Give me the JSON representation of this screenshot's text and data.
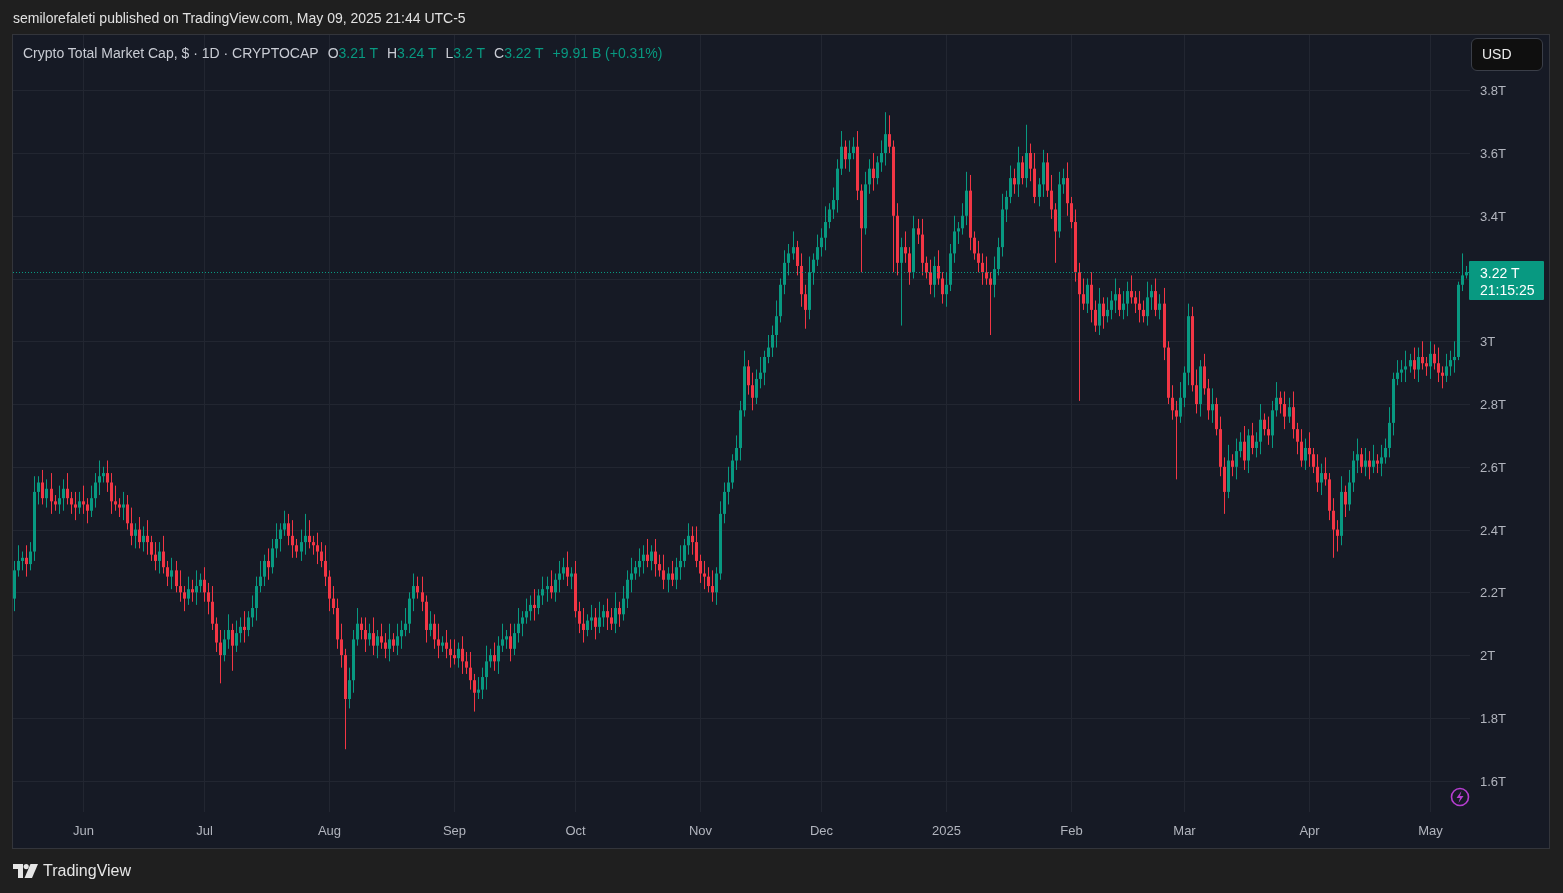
{
  "header": {
    "text": "semilorefaleti published on TradingView.com, May 09, 2025 21:44 UTC-5"
  },
  "legend": {
    "symbol": "Crypto Total Market Cap, $ · 1D · CRYPTOCAP",
    "items": [
      {
        "label": "O",
        "value": "3.21 T"
      },
      {
        "label": "H",
        "value": "3.24 T"
      },
      {
        "label": "L",
        "value": "3.2 T"
      },
      {
        "label": "C",
        "value": "3.22 T"
      }
    ],
    "change": "+9.91 B (+0.31%)"
  },
  "currency_button": {
    "label": "USD"
  },
  "price_tag": {
    "countdown": "21:15:25"
  },
  "chart_data": {
    "type": "candlestick",
    "grid": true,
    "ylim": [
      1.5,
      3.976
    ],
    "yticks": [
      {
        "value": 1.6,
        "label": "1.6T"
      },
      {
        "value": 1.8,
        "label": "1.8T"
      },
      {
        "value": 2,
        "label": "2T"
      },
      {
        "value": 2.2,
        "label": "2.2T"
      },
      {
        "value": 2.4,
        "label": "2.4T"
      },
      {
        "value": 2.6,
        "label": "2.6T"
      },
      {
        "value": 2.8,
        "label": "2.8T"
      },
      {
        "value": 3,
        "label": "3T"
      },
      {
        "value": 3.4,
        "label": "3.4T"
      },
      {
        "value": 3.6,
        "label": "3.6T"
      },
      {
        "value": 3.8,
        "label": "3.8T"
      }
    ],
    "ref_lines": [
      {
        "axis": "y",
        "value": 3.22,
        "label": "3.22 T"
      }
    ],
    "categories": [
      null,
      null,
      null,
      null,
      null,
      null,
      null,
      null,
      null,
      null,
      null,
      null,
      null,
      null,
      null,
      null,
      null,
      "Jun",
      null,
      null,
      null,
      null,
      null,
      null,
      null,
      null,
      null,
      null,
      null,
      null,
      null,
      null,
      null,
      null,
      null,
      null,
      null,
      null,
      null,
      null,
      null,
      null,
      null,
      null,
      null,
      null,
      null,
      "Jul",
      null,
      null,
      null,
      null,
      null,
      null,
      null,
      null,
      null,
      null,
      null,
      null,
      null,
      null,
      null,
      null,
      null,
      null,
      null,
      null,
      null,
      null,
      null,
      null,
      null,
      null,
      null,
      null,
      null,
      null,
      "Aug",
      null,
      null,
      null,
      null,
      null,
      null,
      null,
      null,
      null,
      null,
      null,
      null,
      null,
      null,
      null,
      null,
      null,
      null,
      null,
      null,
      null,
      null,
      null,
      null,
      null,
      null,
      null,
      null,
      null,
      null,
      "Sep",
      null,
      null,
      null,
      null,
      null,
      null,
      null,
      null,
      null,
      null,
      null,
      null,
      null,
      null,
      null,
      null,
      null,
      null,
      null,
      null,
      null,
      null,
      null,
      null,
      null,
      null,
      null,
      null,
      null,
      "Oct",
      null,
      null,
      null,
      null,
      null,
      null,
      null,
      null,
      null,
      null,
      null,
      null,
      null,
      null,
      null,
      null,
      null,
      null,
      null,
      null,
      null,
      null,
      null,
      null,
      null,
      null,
      null,
      null,
      null,
      null,
      "Nov",
      null,
      null,
      null,
      null,
      null,
      null,
      null,
      null,
      null,
      null,
      null,
      null,
      null,
      null,
      null,
      null,
      null,
      null,
      null,
      null,
      null,
      null,
      null,
      null,
      null,
      null,
      null,
      null,
      null,
      "Dec",
      null,
      null,
      null,
      null,
      null,
      null,
      null,
      null,
      null,
      null,
      null,
      null,
      null,
      null,
      null,
      null,
      null,
      null,
      null,
      null,
      null,
      null,
      null,
      null,
      null,
      null,
      null,
      null,
      null,
      null,
      "2025",
      null,
      null,
      null,
      null,
      null,
      null,
      null,
      null,
      null,
      null,
      null,
      null,
      null,
      null,
      null,
      null,
      null,
      null,
      null,
      null,
      null,
      null,
      null,
      null,
      null,
      null,
      null,
      null,
      null,
      null,
      "Feb",
      null,
      null,
      null,
      null,
      null,
      null,
      null,
      null,
      null,
      null,
      null,
      null,
      null,
      null,
      null,
      null,
      null,
      null,
      null,
      null,
      null,
      null,
      null,
      null,
      null,
      null,
      null,
      "Mar",
      null,
      null,
      null,
      null,
      null,
      null,
      null,
      null,
      null,
      null,
      null,
      null,
      null,
      null,
      null,
      null,
      null,
      null,
      null,
      null,
      null,
      null,
      null,
      null,
      null,
      null,
      null,
      null,
      null,
      null,
      "Apr",
      null,
      null,
      null,
      null,
      null,
      null,
      null,
      null,
      null,
      null,
      null,
      null,
      null,
      null,
      null,
      null,
      null,
      null,
      null,
      null,
      null,
      null,
      null,
      null,
      null,
      null,
      null,
      null,
      null,
      "May",
      null,
      null,
      null,
      null,
      null,
      null,
      null,
      null,
      null
    ],
    "ohlc": [
      [
        2.18,
        2.3,
        2.14,
        2.27
      ],
      [
        2.27,
        2.35,
        2.25,
        2.3
      ],
      [
        2.3,
        2.33,
        2.27,
        2.31
      ],
      [
        2.31,
        2.35,
        2.25,
        2.29
      ],
      [
        2.29,
        2.36,
        2.27,
        2.33
      ],
      [
        2.33,
        2.57,
        2.3,
        2.52
      ],
      [
        2.52,
        2.57,
        2.48,
        2.55
      ],
      [
        2.55,
        2.59,
        2.48,
        2.5
      ],
      [
        2.5,
        2.56,
        2.47,
        2.53
      ],
      [
        2.53,
        2.58,
        2.45,
        2.49
      ],
      [
        2.49,
        2.51,
        2.46,
        2.48
      ],
      [
        2.48,
        2.54,
        2.45,
        2.5
      ],
      [
        2.5,
        2.56,
        2.46,
        2.53
      ],
      [
        2.53,
        2.58,
        2.48,
        2.5
      ],
      [
        2.5,
        2.52,
        2.45,
        2.48
      ],
      [
        2.48,
        2.52,
        2.43,
        2.47
      ],
      [
        2.47,
        2.52,
        2.45,
        2.49
      ],
      [
        2.49,
        2.54,
        2.45,
        2.48
      ],
      [
        2.48,
        2.5,
        2.42,
        2.46
      ],
      [
        2.46,
        2.54,
        2.44,
        2.5
      ],
      [
        2.5,
        2.58,
        2.47,
        2.55
      ],
      [
        2.55,
        2.62,
        2.51,
        2.57
      ],
      [
        2.57,
        2.6,
        2.55,
        2.58
      ],
      [
        2.58,
        2.62,
        2.52,
        2.55
      ],
      [
        2.55,
        2.58,
        2.45,
        2.49
      ],
      [
        2.49,
        2.54,
        2.46,
        2.48
      ],
      [
        2.48,
        2.5,
        2.44,
        2.47
      ],
      [
        2.47,
        2.52,
        2.43,
        2.48
      ],
      [
        2.48,
        2.51,
        2.4,
        2.42
      ],
      [
        2.42,
        2.47,
        2.35,
        2.38
      ],
      [
        2.38,
        2.42,
        2.34,
        2.4
      ],
      [
        2.4,
        2.44,
        2.34,
        2.36
      ],
      [
        2.36,
        2.41,
        2.33,
        2.38
      ],
      [
        2.38,
        2.43,
        2.32,
        2.36
      ],
      [
        2.36,
        2.38,
        2.3,
        2.32
      ],
      [
        2.32,
        2.36,
        2.27,
        2.3
      ],
      [
        2.3,
        2.36,
        2.26,
        2.33
      ],
      [
        2.33,
        2.38,
        2.26,
        2.28
      ],
      [
        2.28,
        2.3,
        2.22,
        2.25
      ],
      [
        2.25,
        2.31,
        2.21,
        2.27
      ],
      [
        2.27,
        2.3,
        2.2,
        2.22
      ],
      [
        2.22,
        2.27,
        2.17,
        2.2
      ],
      [
        2.2,
        2.22,
        2.14,
        2.18
      ],
      [
        2.18,
        2.25,
        2.16,
        2.21
      ],
      [
        2.21,
        2.24,
        2.17,
        2.2
      ],
      [
        2.2,
        2.27,
        2.16,
        2.22
      ],
      [
        2.22,
        2.26,
        2.2,
        2.24
      ],
      [
        2.24,
        2.28,
        2.17,
        2.2
      ],
      [
        2.2,
        2.23,
        2.13,
        2.17
      ],
      [
        2.17,
        2.22,
        2.08,
        2.1
      ],
      [
        2.1,
        2.12,
        2.01,
        2.04
      ],
      [
        2.04,
        2.08,
        1.91,
        2.0
      ],
      [
        2.0,
        2.08,
        1.98,
        2.05
      ],
      [
        2.05,
        2.13,
        2.02,
        2.08
      ],
      [
        2.08,
        2.1,
        1.95,
        2.03
      ],
      [
        2.03,
        2.11,
        2.01,
        2.07
      ],
      [
        2.07,
        2.12,
        2.04,
        2.09
      ],
      [
        2.09,
        2.14,
        2.04,
        2.08
      ],
      [
        2.08,
        2.14,
        2.06,
        2.12
      ],
      [
        2.12,
        2.19,
        2.09,
        2.15
      ],
      [
        2.15,
        2.25,
        2.11,
        2.22
      ],
      [
        2.22,
        2.3,
        2.2,
        2.25
      ],
      [
        2.25,
        2.32,
        2.22,
        2.3
      ],
      [
        2.3,
        2.34,
        2.24,
        2.28
      ],
      [
        2.28,
        2.37,
        2.26,
        2.34
      ],
      [
        2.34,
        2.42,
        2.31,
        2.37
      ],
      [
        2.37,
        2.42,
        2.33,
        2.4
      ],
      [
        2.4,
        2.46,
        2.38,
        2.42
      ],
      [
        2.42,
        2.45,
        2.35,
        2.38
      ],
      [
        2.38,
        2.43,
        2.31,
        2.35
      ],
      [
        2.35,
        2.37,
        2.31,
        2.33
      ],
      [
        2.33,
        2.4,
        2.3,
        2.36
      ],
      [
        2.36,
        2.45,
        2.32,
        2.38
      ],
      [
        2.38,
        2.43,
        2.34,
        2.36
      ],
      [
        2.36,
        2.38,
        2.32,
        2.35
      ],
      [
        2.35,
        2.39,
        2.29,
        2.33
      ],
      [
        2.33,
        2.36,
        2.28,
        2.3
      ],
      [
        2.3,
        2.35,
        2.22,
        2.25
      ],
      [
        2.25,
        2.27,
        2.14,
        2.18
      ],
      [
        2.18,
        2.22,
        2.13,
        2.15
      ],
      [
        2.15,
        2.18,
        2.02,
        2.05
      ],
      [
        2.05,
        2.1,
        1.96,
        2.0
      ],
      [
        2.0,
        2.02,
        1.7,
        1.86
      ],
      [
        1.86,
        1.96,
        1.83,
        1.92
      ],
      [
        1.92,
        2.08,
        1.88,
        2.05
      ],
      [
        2.05,
        2.15,
        2.03,
        2.1
      ],
      [
        2.1,
        2.12,
        2.05,
        2.08
      ],
      [
        2.08,
        2.12,
        2.01,
        2.05
      ],
      [
        2.05,
        2.1,
        2.03,
        2.07
      ],
      [
        2.07,
        2.12,
        2.0,
        2.03
      ],
      [
        2.03,
        2.08,
        1.99,
        2.06
      ],
      [
        2.06,
        2.1,
        2.02,
        2.04
      ],
      [
        2.04,
        2.07,
        1.99,
        2.02
      ],
      [
        2.02,
        2.1,
        1.98,
        2.05
      ],
      [
        2.05,
        2.07,
        2.01,
        2.03
      ],
      [
        2.03,
        2.1,
        2.0,
        2.06
      ],
      [
        2.06,
        2.11,
        2.02,
        2.08
      ],
      [
        2.08,
        2.15,
        2.06,
        2.1
      ],
      [
        2.1,
        2.2,
        2.07,
        2.18
      ],
      [
        2.18,
        2.26,
        2.14,
        2.22
      ],
      [
        2.22,
        2.25,
        2.18,
        2.2
      ],
      [
        2.2,
        2.25,
        2.14,
        2.17
      ],
      [
        2.17,
        2.19,
        2.04,
        2.08
      ],
      [
        2.08,
        2.14,
        2.06,
        2.1
      ],
      [
        2.1,
        2.13,
        2.02,
        2.05
      ],
      [
        2.05,
        2.1,
        1.99,
        2.03
      ],
      [
        2.03,
        2.06,
        2.01,
        2.04
      ],
      [
        2.04,
        2.08,
        1.99,
        2.02
      ],
      [
        2.02,
        2.05,
        1.96,
        2.0
      ],
      [
        2.0,
        2.05,
        1.97,
        1.99
      ],
      [
        1.99,
        2.04,
        1.96,
        2.02
      ],
      [
        2.02,
        2.06,
        1.94,
        1.98
      ],
      [
        1.98,
        2.01,
        1.94,
        1.96
      ],
      [
        1.96,
        2.01,
        1.89,
        1.92
      ],
      [
        1.92,
        1.94,
        1.82,
        1.88
      ],
      [
        1.88,
        1.93,
        1.86,
        1.89
      ],
      [
        1.89,
        1.96,
        1.86,
        1.93
      ],
      [
        1.93,
        2.03,
        1.89,
        1.98
      ],
      [
        1.98,
        2.02,
        1.96,
        2.0
      ],
      [
        2.0,
        2.04,
        1.95,
        1.98
      ],
      [
        1.98,
        2.06,
        1.94,
        2.03
      ],
      [
        2.03,
        2.1,
        2.01,
        2.05
      ],
      [
        2.05,
        2.08,
        2.02,
        2.06
      ],
      [
        2.06,
        2.1,
        1.98,
        2.02
      ],
      [
        2.02,
        2.1,
        2.0,
        2.07
      ],
      [
        2.07,
        2.15,
        2.04,
        2.1
      ],
      [
        2.1,
        2.14,
        2.06,
        2.12
      ],
      [
        2.12,
        2.18,
        2.1,
        2.14
      ],
      [
        2.14,
        2.19,
        2.11,
        2.16
      ],
      [
        2.16,
        2.21,
        2.11,
        2.15
      ],
      [
        2.15,
        2.21,
        2.13,
        2.19
      ],
      [
        2.19,
        2.25,
        2.16,
        2.21
      ],
      [
        2.21,
        2.25,
        2.17,
        2.22
      ],
      [
        2.22,
        2.27,
        2.18,
        2.2
      ],
      [
        2.2,
        2.26,
        2.17,
        2.24
      ],
      [
        2.24,
        2.3,
        2.2,
        2.26
      ],
      [
        2.26,
        2.31,
        2.24,
        2.28
      ],
      [
        2.28,
        2.33,
        2.22,
        2.25
      ],
      [
        2.25,
        2.28,
        2.21,
        2.26
      ],
      [
        2.26,
        2.3,
        2.12,
        2.14
      ],
      [
        2.14,
        2.17,
        2.07,
        2.1
      ],
      [
        2.1,
        2.15,
        2.04,
        2.08
      ],
      [
        2.08,
        2.13,
        2.06,
        2.11
      ],
      [
        2.11,
        2.16,
        2.08,
        2.12
      ],
      [
        2.12,
        2.15,
        2.05,
        2.09
      ],
      [
        2.09,
        2.17,
        2.07,
        2.12
      ],
      [
        2.12,
        2.16,
        2.09,
        2.14
      ],
      [
        2.14,
        2.18,
        2.08,
        2.12
      ],
      [
        2.12,
        2.15,
        2.08,
        2.1
      ],
      [
        2.1,
        2.2,
        2.07,
        2.15
      ],
      [
        2.15,
        2.17,
        2.09,
        2.13
      ],
      [
        2.13,
        2.22,
        2.11,
        2.18
      ],
      [
        2.18,
        2.27,
        2.15,
        2.24
      ],
      [
        2.24,
        2.31,
        2.2,
        2.26
      ],
      [
        2.26,
        2.3,
        2.24,
        2.28
      ],
      [
        2.28,
        2.34,
        2.25,
        2.3
      ],
      [
        2.3,
        2.35,
        2.26,
        2.32
      ],
      [
        2.32,
        2.37,
        2.28,
        2.3
      ],
      [
        2.3,
        2.35,
        2.27,
        2.33
      ],
      [
        2.33,
        2.37,
        2.25,
        2.29
      ],
      [
        2.29,
        2.32,
        2.25,
        2.27
      ],
      [
        2.27,
        2.32,
        2.21,
        2.24
      ],
      [
        2.24,
        2.28,
        2.2,
        2.26
      ],
      [
        2.26,
        2.3,
        2.22,
        2.24
      ],
      [
        2.24,
        2.31,
        2.21,
        2.28
      ],
      [
        2.28,
        2.35,
        2.24,
        2.3
      ],
      [
        2.3,
        2.37,
        2.28,
        2.35
      ],
      [
        2.35,
        2.42,
        2.32,
        2.38
      ],
      [
        2.38,
        2.41,
        2.32,
        2.36
      ],
      [
        2.36,
        2.41,
        2.28,
        2.3
      ],
      [
        2.3,
        2.32,
        2.23,
        2.26
      ],
      [
        2.26,
        2.3,
        2.21,
        2.25
      ],
      [
        2.25,
        2.28,
        2.2,
        2.22
      ],
      [
        2.22,
        2.27,
        2.17,
        2.2
      ],
      [
        2.2,
        2.28,
        2.16,
        2.26
      ],
      [
        2.26,
        2.49,
        2.24,
        2.45
      ],
      [
        2.45,
        2.55,
        2.42,
        2.52
      ],
      [
        2.52,
        2.6,
        2.48,
        2.55
      ],
      [
        2.55,
        2.64,
        2.53,
        2.62
      ],
      [
        2.62,
        2.7,
        2.59,
        2.66
      ],
      [
        2.66,
        2.81,
        2.62,
        2.78
      ],
      [
        2.78,
        2.97,
        2.76,
        2.92
      ],
      [
        2.92,
        2.94,
        2.83,
        2.86
      ],
      [
        2.86,
        2.9,
        2.78,
        2.82
      ],
      [
        2.82,
        2.91,
        2.8,
        2.88
      ],
      [
        2.88,
        2.95,
        2.85,
        2.9
      ],
      [
        2.9,
        2.97,
        2.86,
        2.95
      ],
      [
        2.95,
        3.02,
        2.93,
        2.98
      ],
      [
        2.98,
        3.05,
        2.95,
        3.02
      ],
      [
        3.02,
        3.13,
        2.98,
        3.08
      ],
      [
        3.08,
        3.2,
        3.06,
        3.18
      ],
      [
        3.18,
        3.29,
        3.15,
        3.25
      ],
      [
        3.25,
        3.31,
        3.21,
        3.28
      ],
      [
        3.28,
        3.35,
        3.26,
        3.3
      ],
      [
        3.3,
        3.32,
        3.21,
        3.24
      ],
      [
        3.24,
        3.28,
        3.11,
        3.15
      ],
      [
        3.15,
        3.18,
        3.04,
        3.1
      ],
      [
        3.1,
        3.27,
        3.07,
        3.22
      ],
      [
        3.22,
        3.28,
        3.18,
        3.26
      ],
      [
        3.26,
        3.34,
        3.24,
        3.3
      ],
      [
        3.3,
        3.36,
        3.27,
        3.33
      ],
      [
        3.33,
        3.43,
        3.29,
        3.38
      ],
      [
        3.38,
        3.44,
        3.36,
        3.42
      ],
      [
        3.42,
        3.49,
        3.39,
        3.45
      ],
      [
        3.45,
        3.58,
        3.41,
        3.55
      ],
      [
        3.55,
        3.67,
        3.53,
        3.62
      ],
      [
        3.62,
        3.64,
        3.55,
        3.58
      ],
      [
        3.58,
        3.64,
        3.54,
        3.6
      ],
      [
        3.6,
        3.65,
        3.58,
        3.62
      ],
      [
        3.62,
        3.67,
        3.45,
        3.48
      ],
      [
        3.48,
        3.5,
        3.22,
        3.36
      ],
      [
        3.36,
        3.54,
        3.34,
        3.5
      ],
      [
        3.5,
        3.58,
        3.47,
        3.55
      ],
      [
        3.55,
        3.6,
        3.48,
        3.52
      ],
      [
        3.52,
        3.59,
        3.5,
        3.57
      ],
      [
        3.57,
        3.64,
        3.54,
        3.6
      ],
      [
        3.6,
        3.73,
        3.56,
        3.66
      ],
      [
        3.66,
        3.72,
        3.6,
        3.62
      ],
      [
        3.62,
        3.64,
        3.22,
        3.4
      ],
      [
        3.4,
        3.44,
        3.21,
        3.25
      ],
      [
        3.25,
        3.33,
        3.05,
        3.3
      ],
      [
        3.3,
        3.35,
        3.25,
        3.28
      ],
      [
        3.28,
        3.3,
        3.18,
        3.22
      ],
      [
        3.22,
        3.4,
        3.2,
        3.36
      ],
      [
        3.36,
        3.39,
        3.31,
        3.34
      ],
      [
        3.34,
        3.39,
        3.21,
        3.25
      ],
      [
        3.25,
        3.27,
        3.2,
        3.22
      ],
      [
        3.22,
        3.26,
        3.15,
        3.18
      ],
      [
        3.18,
        3.27,
        3.14,
        3.24
      ],
      [
        3.24,
        3.29,
        3.18,
        3.2
      ],
      [
        3.2,
        3.22,
        3.12,
        3.15
      ],
      [
        3.15,
        3.22,
        3.11,
        3.18
      ],
      [
        3.18,
        3.31,
        3.16,
        3.28
      ],
      [
        3.28,
        3.4,
        3.25,
        3.35
      ],
      [
        3.35,
        3.38,
        3.31,
        3.36
      ],
      [
        3.36,
        3.44,
        3.34,
        3.4
      ],
      [
        3.4,
        3.54,
        3.37,
        3.48
      ],
      [
        3.48,
        3.53,
        3.29,
        3.33
      ],
      [
        3.33,
        3.35,
        3.26,
        3.28
      ],
      [
        3.28,
        3.32,
        3.22,
        3.25
      ],
      [
        3.25,
        3.28,
        3.18,
        3.22
      ],
      [
        3.22,
        3.27,
        3.18,
        3.2
      ],
      [
        3.2,
        3.22,
        3.02,
        3.18
      ],
      [
        3.18,
        3.27,
        3.14,
        3.23
      ],
      [
        3.23,
        3.33,
        3.21,
        3.3
      ],
      [
        3.3,
        3.47,
        3.27,
        3.42
      ],
      [
        3.42,
        3.48,
        3.38,
        3.46
      ],
      [
        3.46,
        3.56,
        3.44,
        3.52
      ],
      [
        3.52,
        3.55,
        3.47,
        3.5
      ],
      [
        3.5,
        3.62,
        3.46,
        3.57
      ],
      [
        3.57,
        3.59,
        3.5,
        3.52
      ],
      [
        3.52,
        3.69,
        3.49,
        3.6
      ],
      [
        3.6,
        3.63,
        3.51,
        3.55
      ],
      [
        3.55,
        3.6,
        3.44,
        3.46
      ],
      [
        3.46,
        3.52,
        3.43,
        3.5
      ],
      [
        3.5,
        3.61,
        3.46,
        3.57
      ],
      [
        3.57,
        3.6,
        3.46,
        3.48
      ],
      [
        3.48,
        3.53,
        3.39,
        3.42
      ],
      [
        3.42,
        3.44,
        3.25,
        3.35
      ],
      [
        3.35,
        3.54,
        3.33,
        3.5
      ],
      [
        3.5,
        3.55,
        3.47,
        3.52
      ],
      [
        3.52,
        3.57,
        3.4,
        3.44
      ],
      [
        3.44,
        3.46,
        3.36,
        3.38
      ],
      [
        3.38,
        3.42,
        3.19,
        3.22
      ],
      [
        3.22,
        3.25,
        2.81,
        3.15
      ],
      [
        3.15,
        3.2,
        3.1,
        3.12
      ],
      [
        3.12,
        3.2,
        3.09,
        3.18
      ],
      [
        3.18,
        3.22,
        3.06,
        3.1
      ],
      [
        3.1,
        3.13,
        3.03,
        3.05
      ],
      [
        3.05,
        3.17,
        3.02,
        3.12
      ],
      [
        3.12,
        3.14,
        3.04,
        3.08
      ],
      [
        3.08,
        3.14,
        3.06,
        3.1
      ],
      [
        3.1,
        3.16,
        3.07,
        3.13
      ],
      [
        3.13,
        3.2,
        3.09,
        3.15
      ],
      [
        3.15,
        3.17,
        3.08,
        3.1
      ],
      [
        3.1,
        3.16,
        3.07,
        3.12
      ],
      [
        3.12,
        3.19,
        3.08,
        3.16
      ],
      [
        3.16,
        3.21,
        3.12,
        3.14
      ],
      [
        3.14,
        3.16,
        3.09,
        3.12
      ],
      [
        3.12,
        3.16,
        3.06,
        3.1
      ],
      [
        3.1,
        3.13,
        3.06,
        3.08
      ],
      [
        3.08,
        3.19,
        3.05,
        3.14
      ],
      [
        3.14,
        3.18,
        3.1,
        3.16
      ],
      [
        3.16,
        3.2,
        3.08,
        3.1
      ],
      [
        3.1,
        3.15,
        3.07,
        3.12
      ],
      [
        3.12,
        3.17,
        2.94,
        2.98
      ],
      [
        2.98,
        3.0,
        2.8,
        2.82
      ],
      [
        2.82,
        2.86,
        2.75,
        2.78
      ],
      [
        2.78,
        2.81,
        2.56,
        2.76
      ],
      [
        2.76,
        2.87,
        2.74,
        2.82
      ],
      [
        2.82,
        2.92,
        2.79,
        2.9
      ],
      [
        2.9,
        3.12,
        2.86,
        3.08
      ],
      [
        3.08,
        3.11,
        2.84,
        2.86
      ],
      [
        2.86,
        2.91,
        2.77,
        2.8
      ],
      [
        2.8,
        2.94,
        2.76,
        2.92
      ],
      [
        2.92,
        2.96,
        2.83,
        2.85
      ],
      [
        2.85,
        2.88,
        2.75,
        2.78
      ],
      [
        2.78,
        2.85,
        2.74,
        2.8
      ],
      [
        2.8,
        2.82,
        2.7,
        2.72
      ],
      [
        2.72,
        2.76,
        2.57,
        2.6
      ],
      [
        2.6,
        2.63,
        2.45,
        2.52
      ],
      [
        2.52,
        2.67,
        2.5,
        2.62
      ],
      [
        2.62,
        2.64,
        2.57,
        2.6
      ],
      [
        2.6,
        2.69,
        2.56,
        2.65
      ],
      [
        2.65,
        2.71,
        2.63,
        2.68
      ],
      [
        2.68,
        2.73,
        2.59,
        2.62
      ],
      [
        2.62,
        2.72,
        2.58,
        2.7
      ],
      [
        2.7,
        2.74,
        2.64,
        2.66
      ],
      [
        2.66,
        2.71,
        2.63,
        2.68
      ],
      [
        2.68,
        2.8,
        2.64,
        2.75
      ],
      [
        2.75,
        2.77,
        2.7,
        2.72
      ],
      [
        2.72,
        2.76,
        2.67,
        2.7
      ],
      [
        2.7,
        2.81,
        2.66,
        2.78
      ],
      [
        2.78,
        2.87,
        2.76,
        2.82
      ],
      [
        2.82,
        2.84,
        2.77,
        2.8
      ],
      [
        2.8,
        2.84,
        2.72,
        2.76
      ],
      [
        2.76,
        2.82,
        2.74,
        2.79
      ],
      [
        2.79,
        2.84,
        2.69,
        2.72
      ],
      [
        2.72,
        2.74,
        2.64,
        2.68
      ],
      [
        2.68,
        2.72,
        2.6,
        2.62
      ],
      [
        2.62,
        2.69,
        2.59,
        2.66
      ],
      [
        2.66,
        2.71,
        2.6,
        2.64
      ],
      [
        2.64,
        2.66,
        2.58,
        2.6
      ],
      [
        2.6,
        2.64,
        2.52,
        2.55
      ],
      [
        2.55,
        2.61,
        2.51,
        2.58
      ],
      [
        2.58,
        2.63,
        2.54,
        2.56
      ],
      [
        2.56,
        2.58,
        2.43,
        2.46
      ],
      [
        2.46,
        2.5,
        2.31,
        2.4
      ],
      [
        2.4,
        2.43,
        2.33,
        2.38
      ],
      [
        2.38,
        2.57,
        2.35,
        2.52
      ],
      [
        2.52,
        2.54,
        2.44,
        2.48
      ],
      [
        2.48,
        2.59,
        2.46,
        2.55
      ],
      [
        2.55,
        2.65,
        2.52,
        2.62
      ],
      [
        2.62,
        2.69,
        2.58,
        2.64
      ],
      [
        2.64,
        2.66,
        2.58,
        2.6
      ],
      [
        2.6,
        2.66,
        2.57,
        2.62
      ],
      [
        2.62,
        2.65,
        2.56,
        2.6
      ],
      [
        2.6,
        2.67,
        2.58,
        2.62
      ],
      [
        2.62,
        2.64,
        2.58,
        2.61
      ],
      [
        2.61,
        2.67,
        2.57,
        2.63
      ],
      [
        2.63,
        2.69,
        2.61,
        2.66
      ],
      [
        2.66,
        2.79,
        2.63,
        2.74
      ],
      [
        2.74,
        2.9,
        2.7,
        2.88
      ],
      [
        2.88,
        2.94,
        2.86,
        2.9
      ],
      [
        2.9,
        2.94,
        2.87,
        2.91
      ],
      [
        2.91,
        2.97,
        2.87,
        2.92
      ],
      [
        2.92,
        2.96,
        2.9,
        2.94
      ],
      [
        2.94,
        2.98,
        2.88,
        2.91
      ],
      [
        2.91,
        2.98,
        2.87,
        2.95
      ],
      [
        2.95,
        3.0,
        2.91,
        2.93
      ],
      [
        2.93,
        2.95,
        2.89,
        2.92
      ],
      [
        2.92,
        3.0,
        2.88,
        2.96
      ],
      [
        2.96,
        2.99,
        2.91,
        2.93
      ],
      [
        2.93,
        2.98,
        2.87,
        2.9
      ],
      [
        2.9,
        2.92,
        2.85,
        2.89
      ],
      [
        2.89,
        2.96,
        2.87,
        2.92
      ],
      [
        2.92,
        2.97,
        2.89,
        2.94
      ],
      [
        2.94,
        3.0,
        2.9,
        2.95
      ],
      [
        2.95,
        3.19,
        2.94,
        3.18
      ],
      [
        3.18,
        3.28,
        3.16,
        3.21
      ],
      [
        3.21,
        3.24,
        3.2,
        3.22
      ]
    ]
  },
  "footer": {
    "brand": "TradingView"
  }
}
